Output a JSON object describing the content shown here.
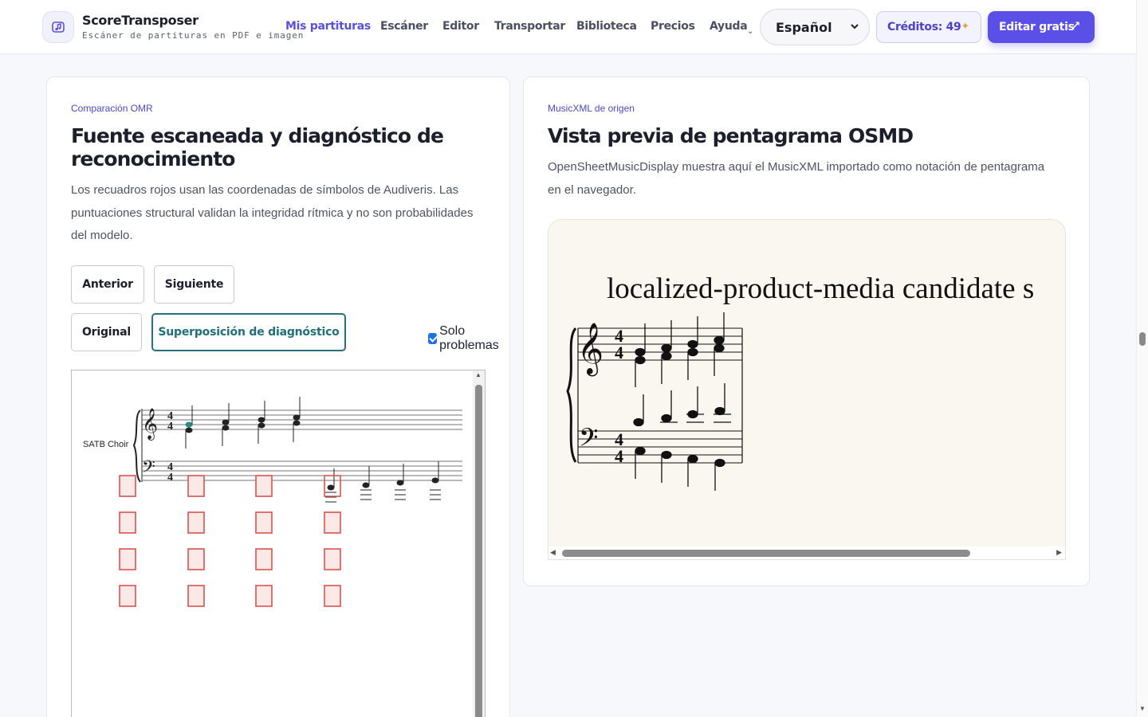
{
  "brand": {
    "name": "ScoreTransposer",
    "tagline": "Escáner de partituras en PDF e imagen"
  },
  "nav": [
    {
      "label": "Mis partituras",
      "active": true
    },
    {
      "label": "Escáner"
    },
    {
      "label": "Editor"
    },
    {
      "label": "Transportar"
    },
    {
      "label": "Biblioteca"
    },
    {
      "label": "Precios"
    },
    {
      "label": "Ayuda",
      "has_dropdown": true
    }
  ],
  "language": {
    "selected": "Español"
  },
  "credits": {
    "label": "Créditos: 49"
  },
  "cta": {
    "label": "Editar gratis"
  },
  "left_card": {
    "eyebrow": "Comparación OMR",
    "title": "Fuente escaneada y diagnóstico de reconocimiento",
    "description": "Los recuadros rojos usan las coordenadas de símbolos de Audiveris. Las puntuaciones structural validan la integridad rítmica y no son probabilidades del modelo.",
    "prev_label": "Anterior",
    "next_label": "Siguiente",
    "view_original_label": "Original",
    "view_overlay_label": "Superposición de diagnóstico",
    "only_problems_label": "Solo problemas",
    "only_problems_checked": true,
    "score_part_label": "SATB Choir",
    "time_signature": [
      "4",
      "4"
    ]
  },
  "right_card": {
    "eyebrow": "MusicXML de origen",
    "title": "Vista previa de pentagrama OSMD",
    "description": "OpenSheetMusicDisplay muestra aquí el MusicXML importado como notación de pentagrama en el navegador.",
    "score_title": "localized-product-media candidate s",
    "time_signature": [
      "4",
      "4"
    ]
  },
  "colors": {
    "accent": "#5a4fe6",
    "selected_teal": "#27707e",
    "diagnostic_red": "#d9534f",
    "diagnostic_fill": "#fbe9e8",
    "checkbox_blue": "#1a73e8"
  },
  "icons": {
    "logo": "music-note-icon",
    "language_chevron": "chevron-down-icon",
    "credits_spark": "sparkle-icon",
    "cta_arrow": "arrow-up-right-icon"
  }
}
